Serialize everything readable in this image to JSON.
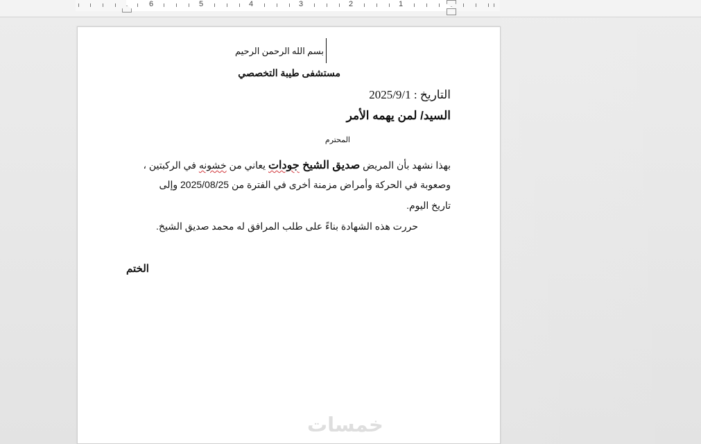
{
  "ruler": {
    "labels": [
      "6",
      "5",
      "4",
      "3",
      "2",
      "1"
    ]
  },
  "document": {
    "bismillah": "بسم الله الرحمن الرحيم",
    "hospital": "مستشفى طيبة التخصصي",
    "date": "التاريخ : 2025/9/1",
    "addressee": "السيد/ لمن يهمه الأمر",
    "honorific": "المحترم",
    "body_line_1_prefix": "بهذا نشهد بأن المريض ",
    "patient_name_part_1": "صديق الشيخ ",
    "patient_name_part_2": "جودات",
    "body_line_1_mid": " يعاني من ",
    "body_word_roughness": "خشونه",
    "body_line_1_suffix": " في الركبتين ،",
    "body_line_2": "وصعوبة في الحركة وأمراض مزمنة أخرى  في الفترة من 2025/08/25 وإلى",
    "body_line_3": "تاريخ اليوم.",
    "body_line_4": "حررت هذه الشهادة بناءً على طلب المرافق له محمد صديق الشيخ.",
    "stamp": "الختم"
  },
  "watermark": "خمسات",
  "colors": {
    "spelling_error": "#d13438",
    "workspace": "#e6e6e6",
    "page": "#ffffff"
  }
}
